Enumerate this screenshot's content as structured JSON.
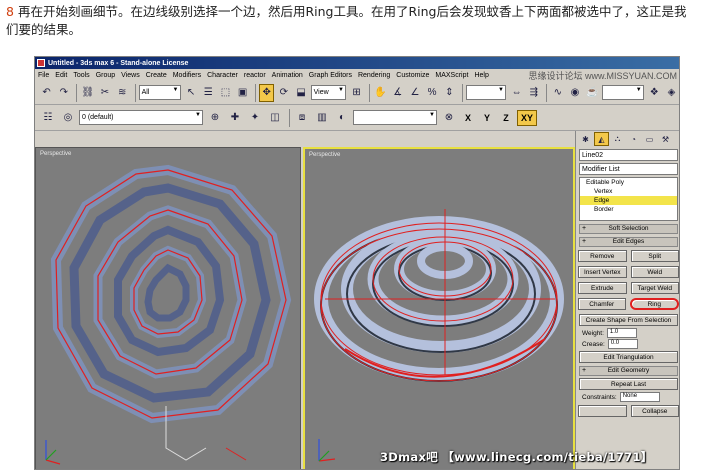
{
  "caption": {
    "step": "8",
    "text": "再在开始刻画细节。在边线级别选择一个边，然后用Ring工具。在用了Ring后会发现蚊香上下两面都被选中了，这正是我 们要的结果。"
  },
  "window": {
    "title": "Untitled - 3ds max 6 - Stand-alone License",
    "menus": [
      "File",
      "Edit",
      "Tools",
      "Group",
      "Views",
      "Create",
      "Modifiers",
      "Character",
      "reactor",
      "Animation",
      "Graph Editors",
      "Rendering",
      "Customize",
      "MAXScript",
      "Help"
    ],
    "watermark_top": "思缘设计论坛 www.MISSYUAN.COM"
  },
  "toolbar1": {
    "selection_filter": "All",
    "view_dropdown": "View"
  },
  "toolbar2": {
    "layer_dropdown": "0 (default)",
    "axes": [
      "X",
      "Y",
      "Z",
      "XY"
    ]
  },
  "viewports": {
    "left_label": "Perspective",
    "right_label": "Perspective"
  },
  "command_panel": {
    "object_name": "Line02",
    "modifier_list": "Modifier List",
    "stack": [
      "Editable Poly",
      "Vertex",
      "Edge",
      "Border"
    ],
    "selected_stack_item": "Edge",
    "rollouts": {
      "soft_selection": "Soft Selection",
      "edit_edges": "Edit Edges",
      "edit_geometry": "Edit Geometry"
    },
    "buttons": {
      "remove": "Remove",
      "split": "Split",
      "insert_vertex": "Insert Vertex",
      "weld": "Weld",
      "extrude": "Extrude",
      "target_weld": "Target Weld",
      "chamfer": "Chamfer",
      "ring": "Ring",
      "create_shape": "Create Shape From Selection",
      "edit_tri": "Edit Triangulation",
      "repeat_last": "Repeat Last",
      "collapse": "Collapse"
    },
    "weight_label": "Weight:",
    "weight_value": "1.0",
    "crease_label": "Crease:",
    "crease_value": "0.0",
    "constraints_label": "Constraints:",
    "constraints_value": "None"
  },
  "watermark_bottom": "3Dmax吧 【www.linecg.com/tieba/1771】",
  "colors": {
    "accent_yellow": "#f3c84a",
    "selected_edge_red": "#e02020",
    "viewport_gray": "#7d7d7d",
    "spiral_blue": "#7e8fb4"
  }
}
